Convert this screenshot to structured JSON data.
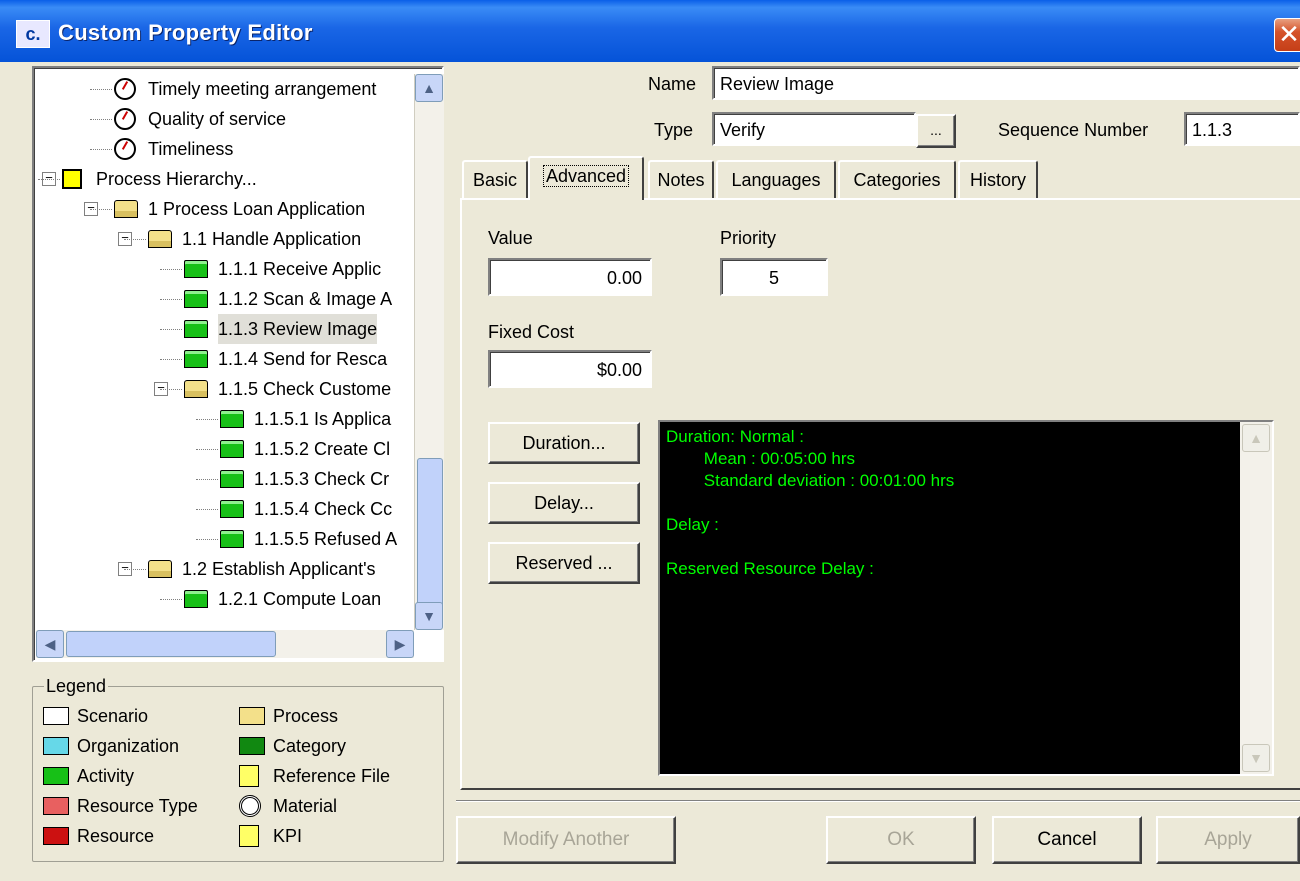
{
  "window": {
    "icon_text": "c.",
    "title": "Custom Property Editor",
    "close_glyph": "✕"
  },
  "tree": {
    "items": [
      {
        "label": "Timely meeting arrangement",
        "icon": "kpi-icon"
      },
      {
        "label": "Quality of service",
        "icon": "kpi-icon"
      },
      {
        "label": "Timeliness",
        "icon": "kpi-icon"
      },
      {
        "label": "Process Hierarchy...",
        "icon": "scenario-icon"
      },
      {
        "label": "1 Process Loan Application",
        "icon": "folder-open-icon"
      },
      {
        "label": "1.1 Handle Application",
        "icon": "folder-open-icon"
      },
      {
        "label": "1.1.1 Receive Applic",
        "icon": "activity-folder-icon"
      },
      {
        "label": "1.1.2 Scan & Image A",
        "icon": "activity-folder-icon"
      },
      {
        "label": "1.1.3 Review Image",
        "icon": "activity-folder-icon"
      },
      {
        "label": "1.1.4 Send for Resca",
        "icon": "activity-folder-icon"
      },
      {
        "label": "1.1.5 Check Custome",
        "icon": "folder-open-icon"
      },
      {
        "label": "1.1.5.1 Is Applica",
        "icon": "activity-folder-icon"
      },
      {
        "label": "1.1.5.2 Create Cl",
        "icon": "activity-folder-icon"
      },
      {
        "label": "1.1.5.3 Check Cr",
        "icon": "activity-folder-icon"
      },
      {
        "label": "1.1.5.4 Check Cc",
        "icon": "activity-folder-icon"
      },
      {
        "label": "1.1.5.5 Refused A",
        "icon": "activity-folder-icon"
      },
      {
        "label": "1.2 Establish Applicant's",
        "icon": "folder-open-icon"
      },
      {
        "label": "1.2.1 Compute Loan",
        "icon": "activity-folder-icon"
      }
    ],
    "expander_minus": "−",
    "scroll_up": "▲",
    "scroll_down": "▼",
    "scroll_left": "◀",
    "scroll_right": "▶"
  },
  "legend": {
    "title": "Legend",
    "items": [
      {
        "label": "Scenario",
        "color": "#ffffff"
      },
      {
        "label": "Process",
        "color": "#f3e08a"
      },
      {
        "label": "Organization",
        "color": "#66d8e8"
      },
      {
        "label": "Category",
        "color": "#118811"
      },
      {
        "label": "Activity",
        "color": "#17c017"
      },
      {
        "label": "Reference File",
        "color": "#ffff66"
      },
      {
        "label": "Resource Type",
        "color": "#e86060"
      },
      {
        "label": "Material",
        "color": "#ffffff"
      },
      {
        "label": "Resource",
        "color": "#cc1111"
      },
      {
        "label": "KPI",
        "color": "#ffff66"
      }
    ]
  },
  "form": {
    "name_label": "Name",
    "name_value": "Review Image",
    "type_label": "Type",
    "type_value": "Verify",
    "browse_label": "...",
    "sequence_label": "Sequence Number",
    "sequence_value": "1.1.3"
  },
  "tabs": [
    "Basic",
    "Advanced",
    "Notes",
    "Languages",
    "Categories",
    "History"
  ],
  "active_tab": "Advanced",
  "advanced": {
    "value_label": "Value",
    "value": "0.00",
    "priority_label": "Priority",
    "priority": "5",
    "fixed_cost_label": "Fixed Cost",
    "fixed_cost": "$0.00",
    "duration_button": "Duration...",
    "delay_button": "Delay...",
    "reserved_button": "Reserved ...",
    "output_lines": [
      "Duration: Normal :",
      "        Mean : 00:05:00 hrs",
      "        Standard deviation : 00:01:00 hrs",
      "",
      "Delay :",
      "",
      "Reserved Resource Delay :"
    ],
    "output_color": "#00ff00"
  },
  "footer": {
    "modify_another": "Modify Another",
    "ok": "OK",
    "cancel": "Cancel",
    "apply": "Apply"
  },
  "colors": {
    "titlebar": "#0553d8",
    "window_bg": "#ece9d8"
  }
}
